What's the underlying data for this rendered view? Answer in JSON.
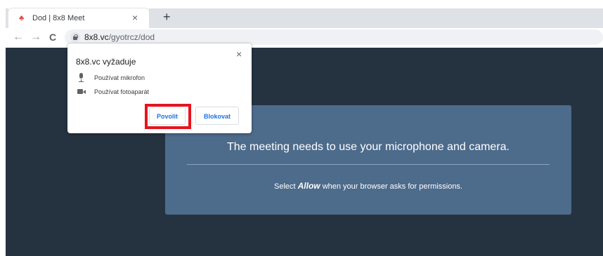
{
  "tab": {
    "title": "Dod | 8x8 Meet",
    "favicon": "♣",
    "close": "×",
    "new_tab": "+"
  },
  "nav": {
    "back": "←",
    "forward": "→",
    "reload": "C"
  },
  "omnibox": {
    "host": "8x8.vc",
    "path": "/gyotrcz/dod"
  },
  "popup": {
    "title": "8x8.vc vyžaduje",
    "close": "×",
    "permissions": [
      {
        "label": "Používat mikrofon",
        "icon": "microphone-icon"
      },
      {
        "label": "Používat fotoaparát",
        "icon": "camera-icon"
      }
    ],
    "allow_label": "Povolit",
    "block_label": "Blokovat"
  },
  "card": {
    "headline": "The meeting needs to use your microphone and camera.",
    "sub_prefix": "Select ",
    "sub_allow": "Allow",
    "sub_suffix": " when your browser asks for permissions."
  },
  "colors": {
    "page_bg": "#253341",
    "card_bg": "#4d6b8b",
    "button_text": "#1a73e8",
    "highlight": "#e8131d"
  }
}
